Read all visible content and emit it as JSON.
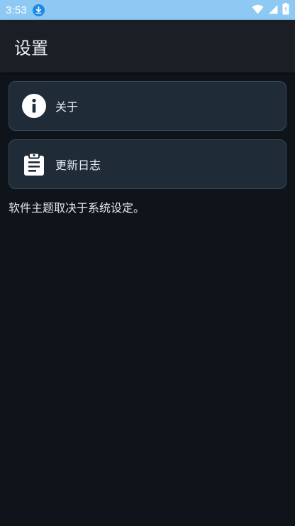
{
  "status_bar": {
    "time": "3:53",
    "icons": [
      "download-icon",
      "wifi-icon",
      "signal-icon",
      "battery-icon"
    ],
    "background": "#8ec9f4"
  },
  "app_bar": {
    "title": "设置"
  },
  "settings": {
    "items": [
      {
        "label": "关于",
        "icon": "info-icon"
      },
      {
        "label": "更新日志",
        "icon": "clipboard-icon"
      }
    ],
    "footnote": "软件主题取决于系统设定。"
  },
  "colors": {
    "background": "#0f141b",
    "app_bar": "#1b1f25",
    "card": "#1f2c38",
    "card_border": "#3a4a58",
    "text": "#e8ecf1"
  }
}
